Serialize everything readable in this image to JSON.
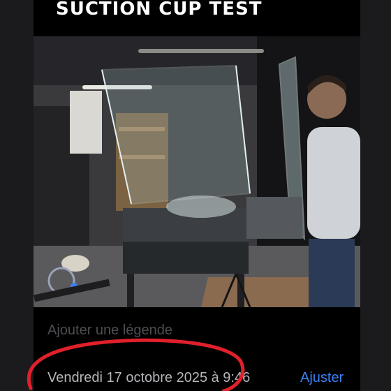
{
  "overlay": {
    "title": "SUCTION CUP TEST"
  },
  "photo": {
    "subject": "glass aquarium suction cup test"
  },
  "info": {
    "caption_placeholder": "Ajouter une légende",
    "date_time": "Vendredi 17 octobre 2025 à 9:46",
    "adjust_label": "Ajuster"
  },
  "colors": {
    "accent": "#3b82f6",
    "annotation": "#e0202a"
  }
}
